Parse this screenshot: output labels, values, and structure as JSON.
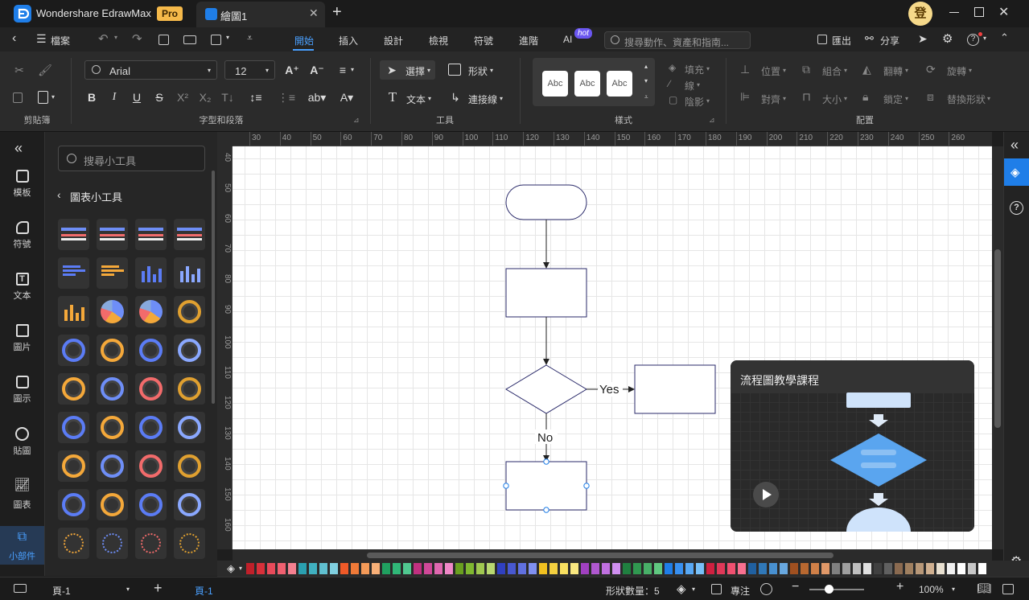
{
  "app": {
    "name": "Wondershare EdrawMax",
    "badge": "Pro",
    "doc_tab": "繪圖1",
    "user_initial": "登"
  },
  "menubar": {
    "file": "檔案",
    "tabs": [
      "開始",
      "插入",
      "設計",
      "檢視",
      "符號",
      "進階",
      "AI"
    ],
    "ai_badge": "hot",
    "search_placeholder": "搜尋動作、資產和指南...",
    "export": "匯出",
    "share": "分享"
  },
  "ribbon": {
    "groups": {
      "clipboard": "剪貼簿",
      "font": "字型和段落",
      "tools": "工具",
      "style": "樣式",
      "arrange": "配置"
    },
    "font_name": "Arial",
    "font_size": "12",
    "select": "選擇",
    "shape": "形狀",
    "text": "文本",
    "connector": "連接線",
    "style_preview": [
      "Abc",
      "Abc",
      "Abc"
    ],
    "fill": "填充",
    "line": "線",
    "shadow": "陰影",
    "position": "位置",
    "group": "組合",
    "flip": "翻轉",
    "rotate": "旋轉",
    "align": "對齊",
    "size": "大小",
    "lock": "鎖定",
    "replace_shape": "替換形狀"
  },
  "leftrail": [
    "模板",
    "符號",
    "文本",
    "圖片",
    "圖示",
    "貼圖",
    "圖表",
    "小部件"
  ],
  "panel": {
    "search_placeholder": "搜尋小工具",
    "back_label": "圖表小工具"
  },
  "ruler": {
    "h": [
      "30",
      "40",
      "50",
      "60",
      "70",
      "80",
      "90",
      "100",
      "110",
      "120",
      "130",
      "140",
      "150",
      "160",
      "170",
      "180",
      "190",
      "200",
      "210",
      "220",
      "230",
      "240",
      "250",
      "260"
    ],
    "v": [
      "40",
      "50",
      "60",
      "70",
      "80",
      "90",
      "100",
      "110",
      "120",
      "130",
      "140",
      "150",
      "160"
    ]
  },
  "flowchart": {
    "yes_label": "Yes",
    "no_label": "No"
  },
  "video": {
    "title": "流程圖教學課程"
  },
  "status": {
    "page_selector": "頁-1",
    "page_tab": "頁-1",
    "shape_count": "形狀數量：5",
    "focus": "專注",
    "zoom": "100%"
  },
  "colors": {
    "accent": "#1f7ee8",
    "ribbon": "#2b2b2b",
    "titlebar": "#1b1b1b"
  }
}
